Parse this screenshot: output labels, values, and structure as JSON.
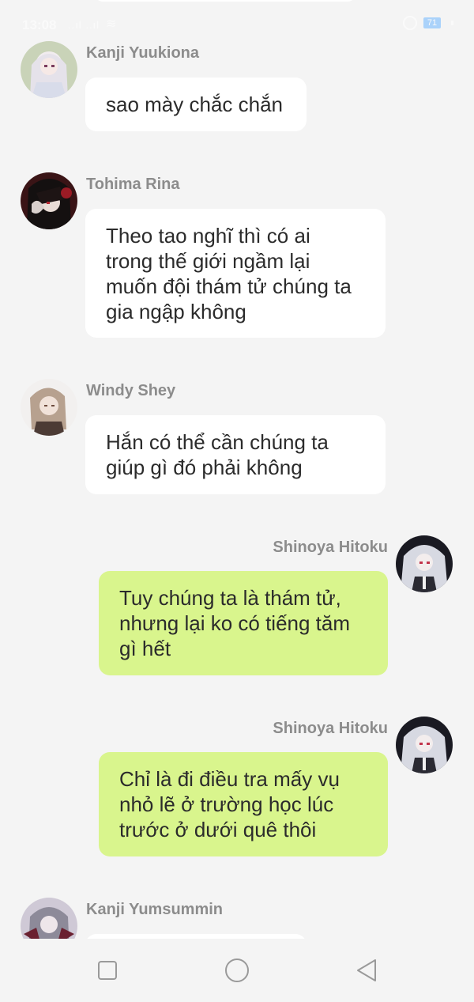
{
  "status_bar": {
    "time": "13:08",
    "signal": "..ıl ..ıl",
    "wifi": "≋",
    "battery": "71"
  },
  "messages": [
    {
      "side": "in",
      "sender": "Kanji Yuukiona",
      "avatar": "avatar-kanji-yuukiona",
      "lines": [
        "sao mày chắc chắn"
      ]
    },
    {
      "side": "in",
      "sender": "Tohima Rina",
      "avatar": "avatar-tohima-rina",
      "lines": [
        "Theo tao nghĩ thì có ai",
        "trong thế giới ngầm lại",
        "muốn đội thám tử chúng ta",
        "gia ngập không"
      ]
    },
    {
      "side": "in",
      "sender": "Windy Shey",
      "avatar": "avatar-windy-shey",
      "lines": [
        "Hắn có thể cần chúng ta",
        "giúp gì đó phải không"
      ]
    },
    {
      "side": "out",
      "sender": "Shinoya Hitoku",
      "avatar": "avatar-shinoya-hitoku",
      "lines": [
        "Tuy chúng ta là thám tử,",
        "nhưng lại ko có tiếng tăm",
        "gì hết"
      ]
    },
    {
      "side": "out",
      "sender": "Shinoya Hitoku",
      "avatar": "avatar-shinoya-hitoku",
      "lines": [
        "Chỉ là đi điều tra mấy vụ",
        "nhỏ lẽ ở trường học lúc",
        "trước ở dưới quê thôi"
      ]
    },
    {
      "side": "in",
      "sender": "Kanji Yumsummin",
      "avatar": "avatar-kanji-yumsummin",
      "lines": []
    }
  ],
  "nav": {
    "items": [
      "recent-apps-button",
      "home-button",
      "back-button"
    ]
  },
  "colors": {
    "background": "#f4f4f4",
    "incoming_bubble": "#ffffff",
    "outgoing_bubble": "#d9f58d",
    "sender_text": "#8c8c8c",
    "message_text": "#2b2b2b"
  }
}
